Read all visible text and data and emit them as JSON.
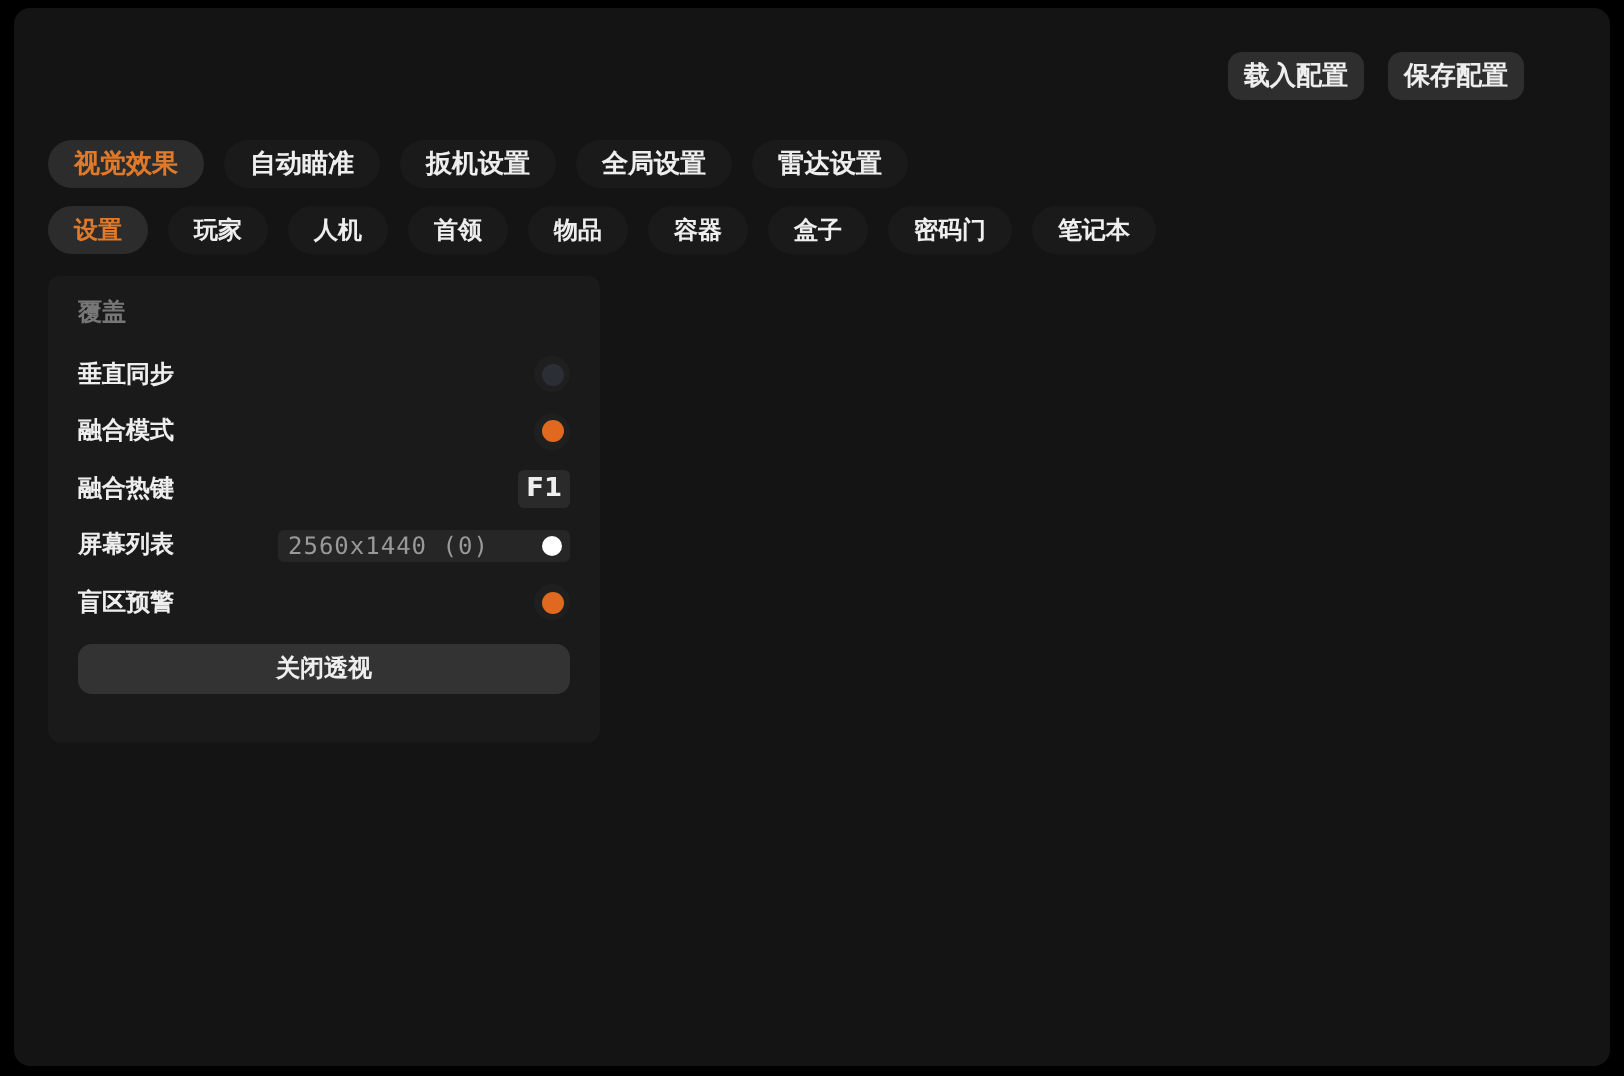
{
  "toolbar": {
    "buttons": [
      "载入配置",
      "保存配置"
    ]
  },
  "tabs": [
    {
      "label": "视觉效果",
      "selected": true
    },
    {
      "label": "自动瞄准",
      "selected": false
    },
    {
      "label": "扳机设置",
      "selected": false
    },
    {
      "label": "全局设置",
      "selected": false
    },
    {
      "label": "雷达设置",
      "selected": false
    }
  ],
  "subtabs": [
    {
      "label": "设置",
      "selected": true
    },
    {
      "label": "玩家",
      "selected": false
    },
    {
      "label": "人机",
      "selected": false
    },
    {
      "label": "首领",
      "selected": false
    },
    {
      "label": "物品",
      "selected": false
    },
    {
      "label": "容器",
      "selected": false
    },
    {
      "label": "盒子",
      "selected": false
    },
    {
      "label": "密码门",
      "selected": false
    },
    {
      "label": "笔记本",
      "selected": false
    }
  ],
  "panel": {
    "title": "覆盖",
    "rows": [
      {
        "kind": "toggle",
        "label": "垂直同步",
        "on": false
      },
      {
        "kind": "toggle",
        "label": "融合模式",
        "on": true
      },
      {
        "kind": "key",
        "label": "融合热键",
        "value": "F1"
      },
      {
        "kind": "select",
        "label": "屏幕列表",
        "value": "2560x1440 (0)"
      },
      {
        "kind": "toggle",
        "label": "盲区预警",
        "on": true
      }
    ],
    "button": "关闭透视"
  }
}
